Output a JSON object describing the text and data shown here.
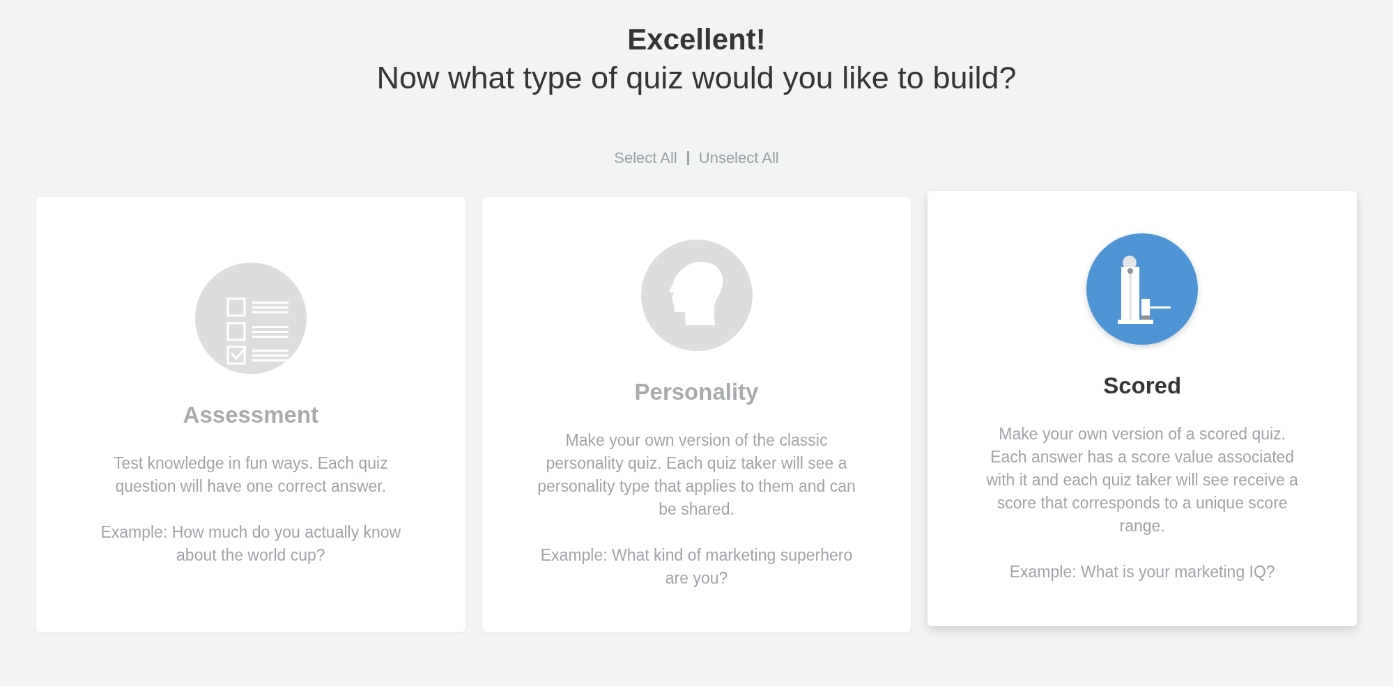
{
  "heading": {
    "title": "Excellent!",
    "subtitle": "Now what type of quiz would you like to build?"
  },
  "selection_links": [
    "Select All",
    "Unselect All"
  ],
  "cards": [
    {
      "kind": "checklist",
      "title": "Assessment",
      "description": "Test knowledge in fun ways. Each quiz question will have one correct answer.",
      "example": "Example: How much do you actually know about the world cup?",
      "selected": false
    },
    {
      "kind": "head",
      "title": "Personality",
      "description": "Make your own version of the classic personality quiz. Each quiz taker will see a personality type that applies to them and can be shared.",
      "example": "Example: What kind of marketing superhero are you?",
      "selected": false
    },
    {
      "kind": "strength-tester",
      "title": "Scored",
      "description": "Make your own version of a scored quiz. Each answer has a score value associated with it and each quiz taker will see receive a score that corresponds to a unique score range.",
      "example": "Example: What is your marketing IQ?",
      "selected": true
    }
  ]
}
